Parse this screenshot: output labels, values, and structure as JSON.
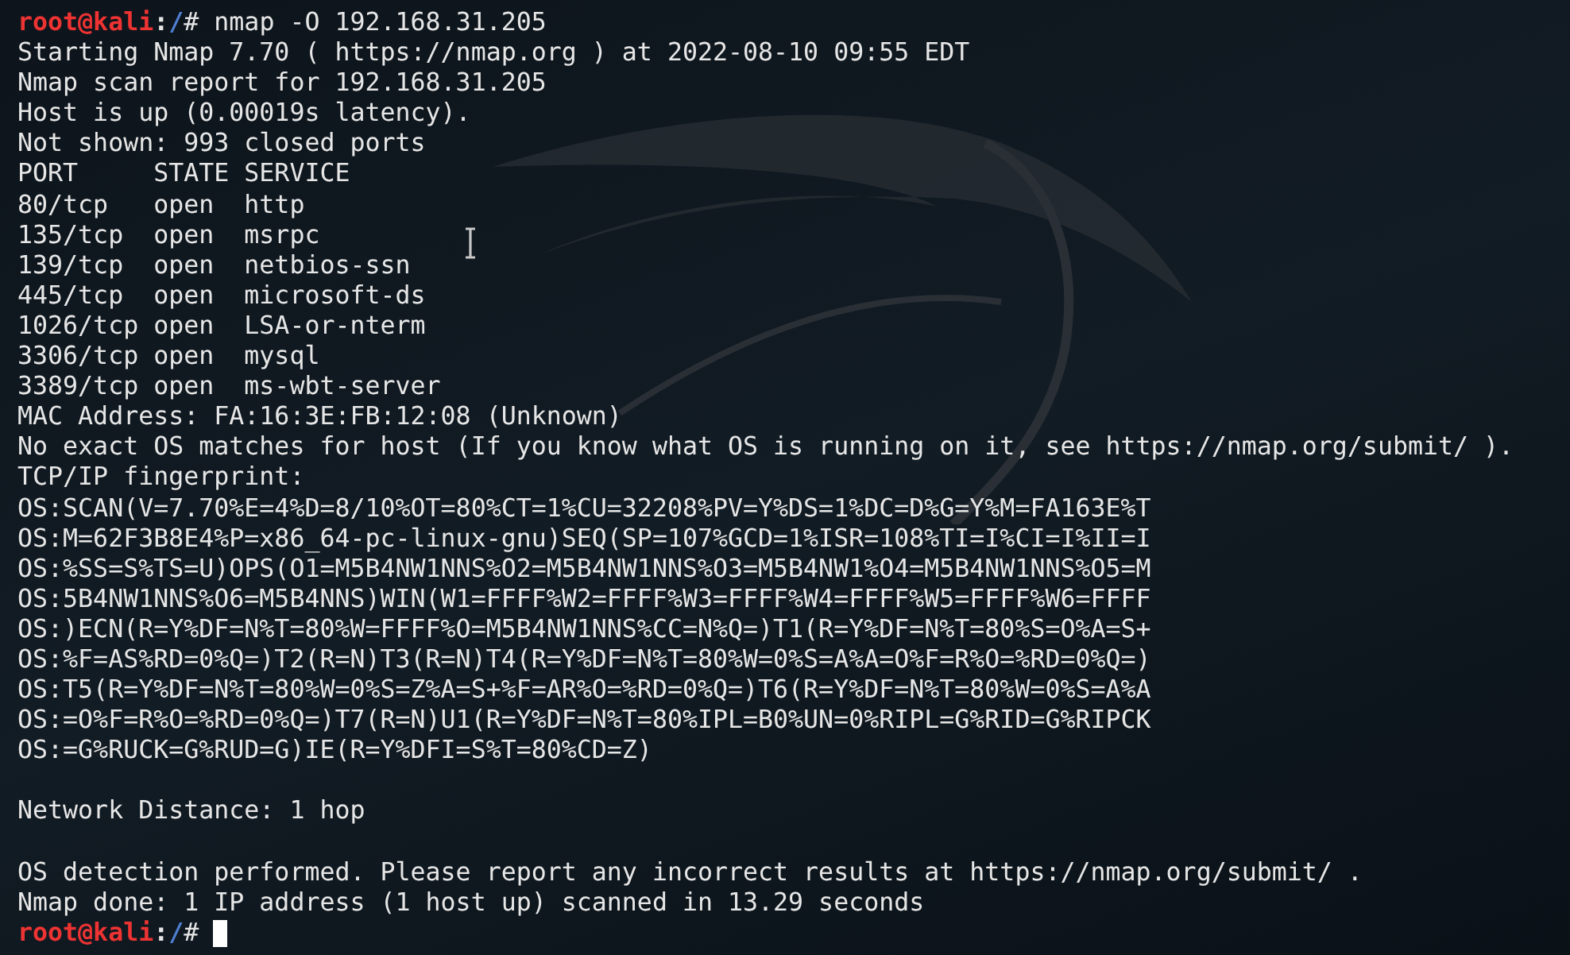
{
  "terminal": {
    "lines": [
      {
        "kind": "prompt",
        "user": "root@kali",
        "separator": ":",
        "path": "/",
        "symbol": "#",
        "command": "nmap -O 192.168.31.205",
        "cursor": false
      },
      {
        "kind": "output",
        "text": "Starting Nmap 7.70 ( https://nmap.org ) at 2022-08-10 09:55 EDT"
      },
      {
        "kind": "output",
        "text": "Nmap scan report for 192.168.31.205"
      },
      {
        "kind": "output",
        "text": "Host is up (0.00019s latency)."
      },
      {
        "kind": "output",
        "text": "Not shown: 993 closed ports"
      },
      {
        "kind": "output",
        "text": "PORT     STATE SERVICE"
      },
      {
        "kind": "output",
        "text": "80/tcp   open  http"
      },
      {
        "kind": "output",
        "text": "135/tcp  open  msrpc"
      },
      {
        "kind": "output",
        "text": "139/tcp  open  netbios-ssn"
      },
      {
        "kind": "output",
        "text": "445/tcp  open  microsoft-ds"
      },
      {
        "kind": "output",
        "text": "1026/tcp open  LSA-or-nterm"
      },
      {
        "kind": "output",
        "text": "3306/tcp open  mysql"
      },
      {
        "kind": "output",
        "text": "3389/tcp open  ms-wbt-server"
      },
      {
        "kind": "output",
        "text": "MAC Address: FA:16:3E:FB:12:08 (Unknown)"
      },
      {
        "kind": "output",
        "text": "No exact OS matches for host (If you know what OS is running on it, see https://nmap.org/submit/ )."
      },
      {
        "kind": "output",
        "text": "TCP/IP fingerprint:"
      },
      {
        "kind": "output",
        "text": "OS:SCAN(V=7.70%E=4%D=8/10%OT=80%CT=1%CU=32208%PV=Y%DS=1%DC=D%G=Y%M=FA163E%T"
      },
      {
        "kind": "output",
        "text": "OS:M=62F3B8E4%P=x86_64-pc-linux-gnu)SEQ(SP=107%GCD=1%ISR=108%TI=I%CI=I%II=I"
      },
      {
        "kind": "output",
        "text": "OS:%SS=S%TS=U)OPS(O1=M5B4NW1NNS%O2=M5B4NW1NNS%O3=M5B4NW1%O4=M5B4NW1NNS%O5=M"
      },
      {
        "kind": "output",
        "text": "OS:5B4NW1NNS%O6=M5B4NNS)WIN(W1=FFFF%W2=FFFF%W3=FFFF%W4=FFFF%W5=FFFF%W6=FFFF"
      },
      {
        "kind": "output",
        "text": "OS:)ECN(R=Y%DF=N%T=80%W=FFFF%O=M5B4NW1NNS%CC=N%Q=)T1(R=Y%DF=N%T=80%S=O%A=S+"
      },
      {
        "kind": "output",
        "text": "OS:%F=AS%RD=0%Q=)T2(R=N)T3(R=N)T4(R=Y%DF=N%T=80%W=0%S=A%A=O%F=R%O=%RD=0%Q=)"
      },
      {
        "kind": "output",
        "text": "OS:T5(R=Y%DF=N%T=80%W=0%S=Z%A=S+%F=AR%O=%RD=0%Q=)T6(R=Y%DF=N%T=80%W=0%S=A%A"
      },
      {
        "kind": "output",
        "text": "OS:=O%F=R%O=%RD=0%Q=)T7(R=N)U1(R=Y%DF=N%T=80%IPL=B0%UN=0%RIPL=G%RID=G%RIPCK"
      },
      {
        "kind": "output",
        "text": "OS:=G%RUCK=G%RUD=G)IE(R=Y%DFI=S%T=80%CD=Z)"
      },
      {
        "kind": "blank"
      },
      {
        "kind": "output",
        "text": "Network Distance: 1 hop"
      },
      {
        "kind": "blank"
      },
      {
        "kind": "output",
        "text": "OS detection performed. Please report any incorrect results at https://nmap.org/submit/ ."
      },
      {
        "kind": "output",
        "text": "Nmap done: 1 IP address (1 host up) scanned in 13.29 seconds"
      },
      {
        "kind": "prompt",
        "user": "root@kali",
        "separator": ":",
        "path": "/",
        "symbol": "#",
        "cursor": true
      }
    ]
  }
}
